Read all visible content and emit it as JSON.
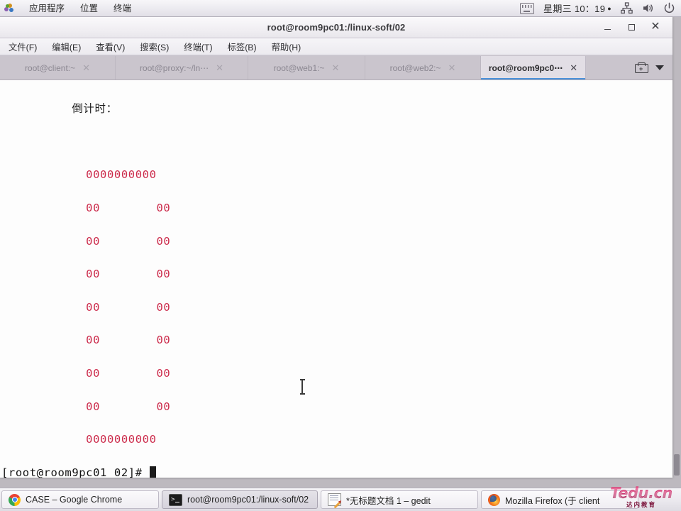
{
  "panel": {
    "apps_icon": "applications-icon",
    "menus": [
      {
        "label": "应用程序",
        "name": "panel-menu-applications"
      },
      {
        "label": "位置",
        "name": "panel-menu-places"
      },
      {
        "label": "终端",
        "name": "panel-menu-terminal"
      }
    ],
    "keyboard_icon": "keyboard-icon",
    "clock": "星期三 10：19",
    "clock_dot": "●",
    "network_icon": "network-icon",
    "volume_icon": "volume-icon",
    "power_icon": "power-icon"
  },
  "window": {
    "title": "root@room9pc01:/linux-soft/02",
    "minimize_label": "",
    "maximize_label": "",
    "close_label": "✕",
    "menubar": [
      {
        "label": "文件(F)",
        "name": "menu-file"
      },
      {
        "label": "编辑(E)",
        "name": "menu-edit"
      },
      {
        "label": "查看(V)",
        "name": "menu-view"
      },
      {
        "label": "搜索(S)",
        "name": "menu-search"
      },
      {
        "label": "终端(T)",
        "name": "menu-terminal"
      },
      {
        "label": "标签(B)",
        "name": "menu-tabs"
      },
      {
        "label": "帮助(H)",
        "name": "menu-help"
      }
    ],
    "tabs": [
      {
        "label": "root@client:~",
        "close": "✕",
        "active": false
      },
      {
        "label": "root@proxy:~/ln⋯",
        "close": "✕",
        "active": false
      },
      {
        "label": "root@web1:~",
        "close": "✕",
        "active": false
      },
      {
        "label": "root@web2:~",
        "close": "✕",
        "active": false
      },
      {
        "label": "root@room9pc0⋯",
        "close": "✕",
        "active": true
      }
    ],
    "new_tab_icon": "new-tab-icon",
    "tab_list_icon": "chevron-down-icon"
  },
  "terminal": {
    "heading": "          倒计时：",
    "art_rows": [
      "            0000000000",
      "            00        00",
      "            00        00",
      "            00        00",
      "            00        00",
      "            00        00",
      "            00        00",
      "            00        00",
      "            0000000000"
    ],
    "art_color": "#cc2b4b",
    "prompt": "[root@room9pc01 02]# ",
    "cursor": "block-cursor",
    "mouse_cursor": "i-beam-cursor"
  },
  "taskbar": {
    "items": [
      {
        "label": "CASE – Google Chrome",
        "icon": "chrome-icon",
        "active": false
      },
      {
        "label": "root@room9pc01:/linux-soft/02",
        "icon": "terminal-icon",
        "active": true
      },
      {
        "label": "*无标题文档 1 – gedit",
        "icon": "gedit-icon",
        "active": false
      },
      {
        "label": "Mozilla Firefox (于 client",
        "icon": "firefox-icon",
        "active": false
      }
    ]
  },
  "watermark": {
    "main": "Tedu.cn",
    "sub": "达内教育"
  }
}
